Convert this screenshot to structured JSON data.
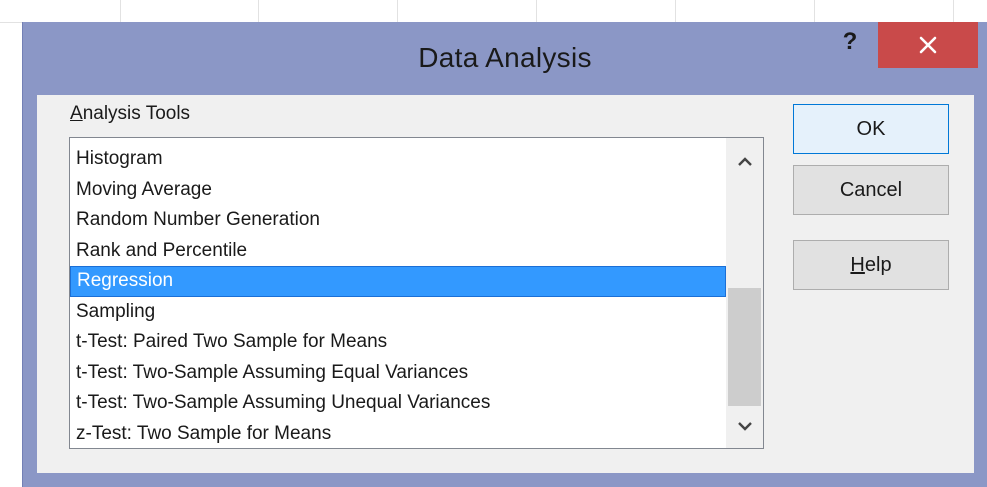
{
  "dialog": {
    "title": "Data Analysis",
    "help_glyph": "?",
    "close_glyph": "✕"
  },
  "analysis_tools": {
    "label_access_key": "A",
    "label_rest": "nalysis Tools",
    "items": [
      "Histogram",
      "Moving Average",
      "Random Number Generation",
      "Rank and Percentile",
      "Regression",
      "Sampling",
      "t-Test: Paired Two Sample for Means",
      "t-Test: Two-Sample Assuming Equal Variances",
      "t-Test: Two-Sample Assuming Unequal Variances",
      "z-Test: Two Sample for Means"
    ],
    "selected": "Regression"
  },
  "buttons": {
    "ok": "OK",
    "cancel": "Cancel",
    "help_access_key": "H",
    "help_rest": "elp"
  },
  "colors": {
    "dialog_frame": "#8b97c6",
    "close_button": "#c94a4a",
    "selection": "#3399ff"
  }
}
